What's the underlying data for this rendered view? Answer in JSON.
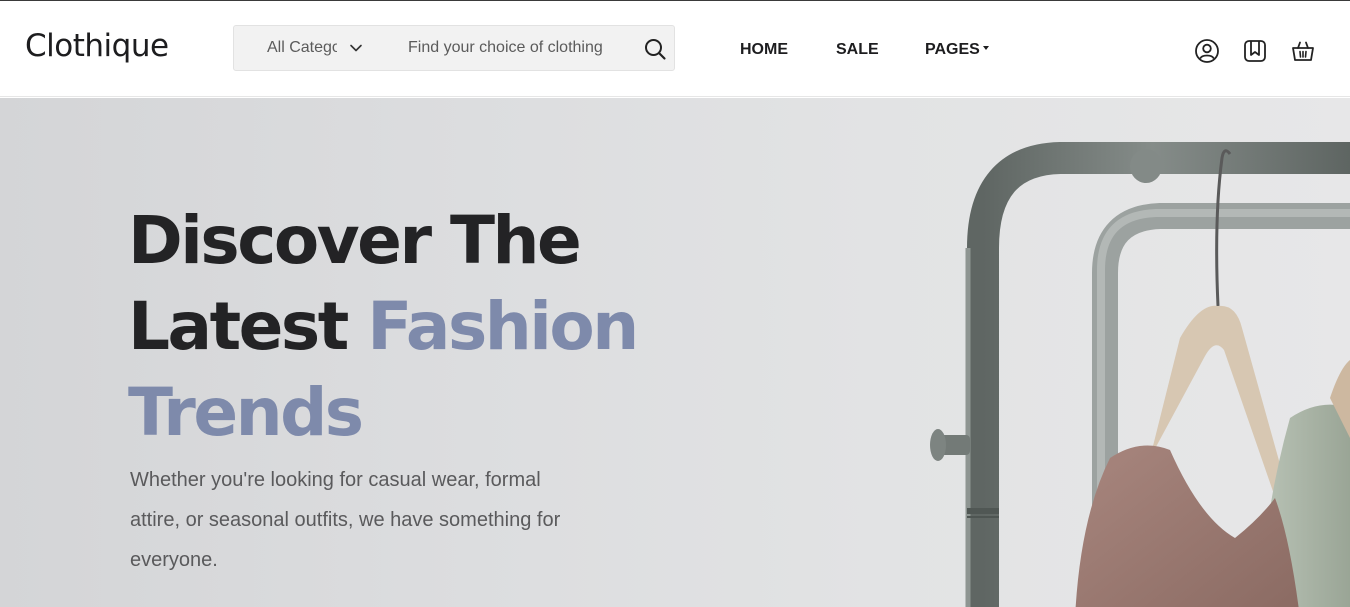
{
  "brand": {
    "logo_text": "Clothique"
  },
  "search": {
    "category_selected": "All Categories",
    "placeholder": "Find your choice of clothing"
  },
  "nav": {
    "items": [
      "HOME",
      "SALE",
      "PAGES"
    ]
  },
  "header_icons": [
    "user-icon",
    "bookmark-icon",
    "basket-icon"
  ],
  "hero": {
    "headline": {
      "part1": "Discover",
      "part2": " The",
      "part3": "Latest ",
      "part4": "Fashion",
      "part5": "Trends"
    },
    "subtext": "Whether you're looking for casual wear, formal attire, or seasonal outfits, we have something for everyone."
  },
  "colors": {
    "accent": "#7e8aab",
    "text_dark": "#232325",
    "hero_bg": "#dcdddf",
    "rack": "#6f7673"
  }
}
